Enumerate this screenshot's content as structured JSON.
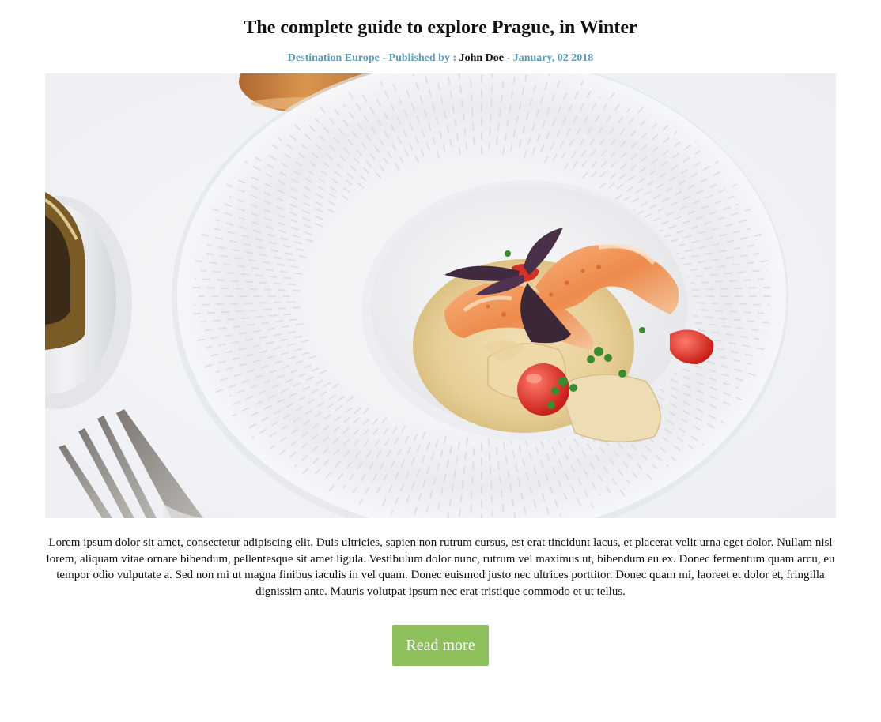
{
  "article": {
    "title": "The complete guide to explore Prague, in Winter",
    "meta": {
      "category": "Destination Europe",
      "separator_1": " - ",
      "published_by": "Published by : ",
      "author": "John Doe",
      "separator_2": " - ",
      "date": "January, 02 2018"
    },
    "image_alt": "Plate of shrimp ravioli",
    "body": "Lorem ipsum dolor sit amet, consectetur adipiscing elit. Duis ultricies, sapien non rutrum cursus, est erat tincidunt lacus, et placerat velit urna eget dolor. Nullam nisl lorem, aliquam vitae ornare bibendum, pellentesque sit amet ligula. Vestibulum dolor nunc, rutrum vel maximus ut, bibendum eu ex. Donec fermentum quam arcu, eu tempor odio vulputate a. Sed non mi ut magna finibus iaculis in vel quam. Donec euismod justo nec ultrices porttitor. Donec quam mi, laoreet et dolor et, fringilla dignissim ante. Mauris volutpat ipsum nec erat tristique commodo et ut tellus.",
    "read_more_label": "Read more"
  },
  "colors": {
    "meta_accent": "#5b9bb4",
    "button_bg": "#8dbf5a",
    "button_text": "#ffffff"
  }
}
